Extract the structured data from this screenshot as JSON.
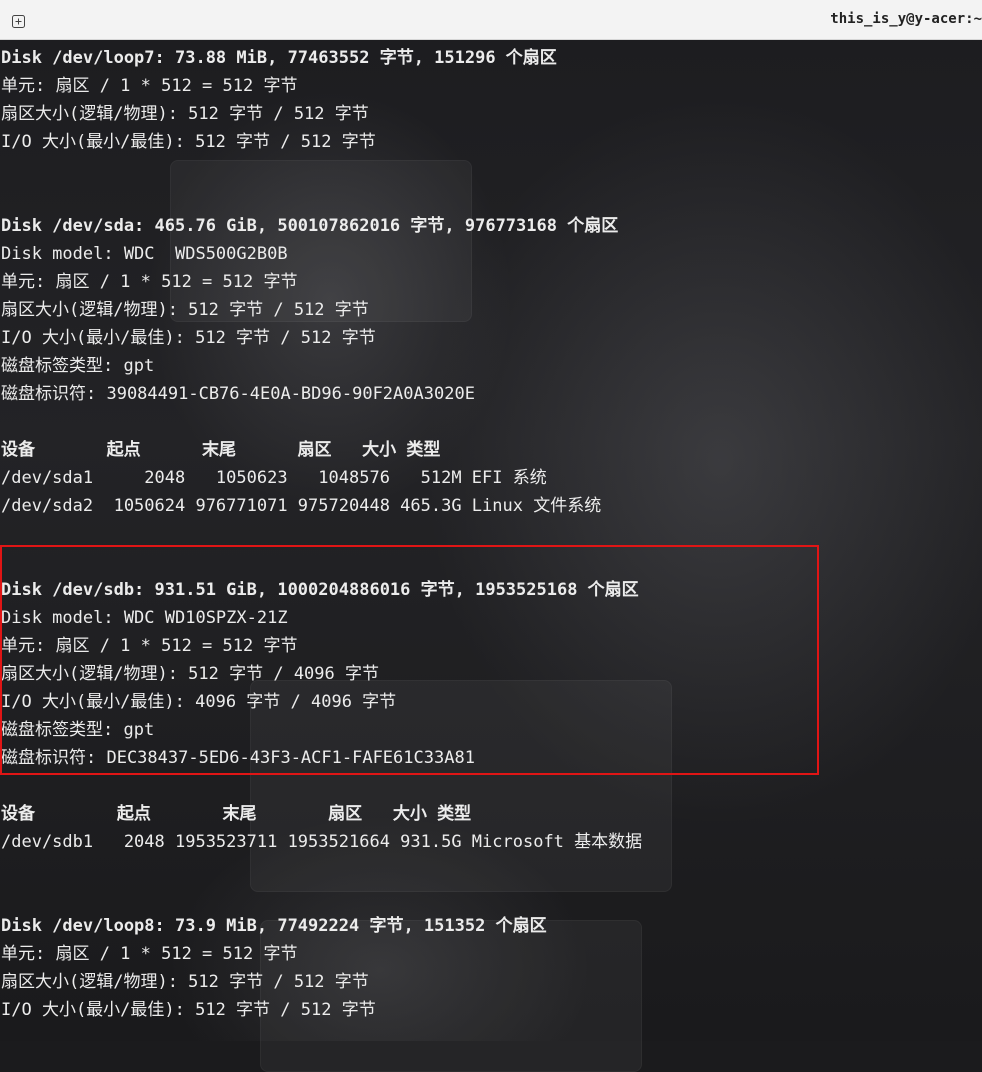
{
  "window": {
    "title": "this_is_y@y-acer:~"
  },
  "terminal": {
    "lines": [
      {
        "text": "Disk /dev/loop7: 73.88 MiB, 77463552 字节, 151296 个扇区",
        "bold": true
      },
      {
        "text": "单元: 扇区 / 1 * 512 = 512 字节",
        "bold": false
      },
      {
        "text": "扇区大小(逻辑/物理): 512 字节 / 512 字节",
        "bold": false
      },
      {
        "text": "I/O 大小(最小/最佳): 512 字节 / 512 字节",
        "bold": false
      },
      {
        "text": "",
        "bold": false
      },
      {
        "text": "",
        "bold": false
      },
      {
        "text": "Disk /dev/sda: 465.76 GiB, 500107862016 字节, 976773168 个扇区",
        "bold": true
      },
      {
        "text": "Disk model: WDC  WDS500G2B0B",
        "bold": false
      },
      {
        "text": "单元: 扇区 / 1 * 512 = 512 字节",
        "bold": false
      },
      {
        "text": "扇区大小(逻辑/物理): 512 字节 / 512 字节",
        "bold": false
      },
      {
        "text": "I/O 大小(最小/最佳): 512 字节 / 512 字节",
        "bold": false
      },
      {
        "text": "磁盘标签类型: gpt",
        "bold": false
      },
      {
        "text": "磁盘标识符: 39084491-CB76-4E0A-BD96-90F2A0A3020E",
        "bold": false
      },
      {
        "text": "",
        "bold": false
      },
      {
        "text": "设备       起点      末尾      扇区   大小 类型",
        "bold": true
      },
      {
        "text": "/dev/sda1     2048   1050623   1048576   512M EFI 系统",
        "bold": false
      },
      {
        "text": "/dev/sda2  1050624 976771071 975720448 465.3G Linux 文件系统",
        "bold": false
      },
      {
        "text": "",
        "bold": false
      },
      {
        "text": "",
        "bold": false
      },
      {
        "text": "Disk /dev/sdb: 931.51 GiB, 1000204886016 字节, 1953525168 个扇区",
        "bold": true
      },
      {
        "text": "Disk model: WDC WD10SPZX-21Z",
        "bold": false
      },
      {
        "text": "单元: 扇区 / 1 * 512 = 512 字节",
        "bold": false
      },
      {
        "text": "扇区大小(逻辑/物理): 512 字节 / 4096 字节",
        "bold": false
      },
      {
        "text": "I/O 大小(最小/最佳): 4096 字节 / 4096 字节",
        "bold": false
      },
      {
        "text": "磁盘标签类型: gpt",
        "bold": false
      },
      {
        "text": "磁盘标识符: DEC38437-5ED6-43F3-ACF1-FAFE61C33A81",
        "bold": false
      },
      {
        "text": "",
        "bold": false
      },
      {
        "text": "设备        起点       末尾       扇区   大小 类型",
        "bold": true
      },
      {
        "text": "/dev/sdb1   2048 1953523711 1953521664 931.5G Microsoft 基本数据",
        "bold": false
      },
      {
        "text": "",
        "bold": false
      },
      {
        "text": "",
        "bold": false
      },
      {
        "text": "Disk /dev/loop8: 73.9 MiB, 77492224 字节, 151352 个扇区",
        "bold": true
      },
      {
        "text": "单元: 扇区 / 1 * 512 = 512 字节",
        "bold": false
      },
      {
        "text": "扇区大小(逻辑/物理): 512 字节 / 512 字节",
        "bold": false
      },
      {
        "text": "I/O 大小(最小/最佳): 512 字节 / 512 字节",
        "bold": false
      }
    ]
  },
  "annotation": {
    "highlight_color": "#e01515"
  }
}
